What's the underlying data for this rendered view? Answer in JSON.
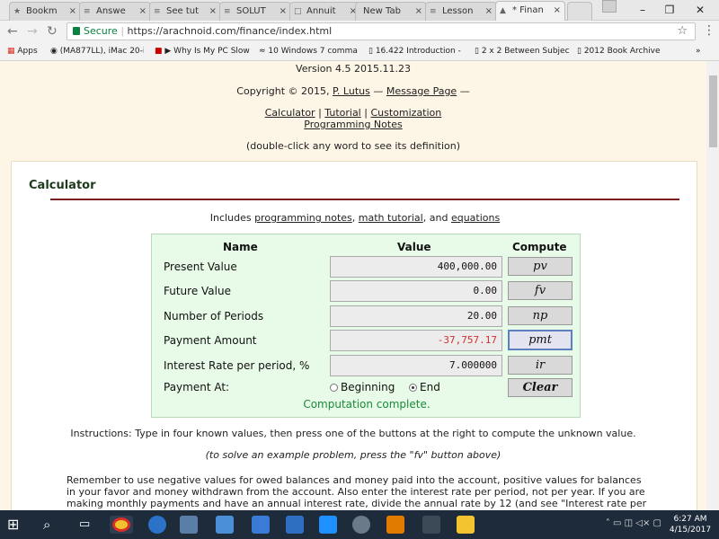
{
  "tabs": [
    {
      "label": "Bookm",
      "icon": "★"
    },
    {
      "label": "Answe",
      "icon": "≡"
    },
    {
      "label": "See tut",
      "icon": "≡"
    },
    {
      "label": "SOLUT",
      "icon": "≡"
    },
    {
      "label": "Annuit",
      "icon": "□"
    },
    {
      "label": "New Tab",
      "icon": ""
    },
    {
      "label": "Lesson",
      "icon": "≡"
    },
    {
      "label": "* Finan",
      "icon": "▲"
    }
  ],
  "address": {
    "secure": "Secure",
    "url": "https://arachnoid.com/finance/index.html"
  },
  "bookmarks": [
    {
      "label": "Apps"
    },
    {
      "label": "(MA877LL), iMac 20-i"
    },
    {
      "label": "▶ Why Is My PC Slow"
    },
    {
      "label": "10 Windows 7 comma"
    },
    {
      "label": "16.422 Introduction -"
    },
    {
      "label": "2 x 2 Between Subjec"
    },
    {
      "label": "2012 Book Archive"
    }
  ],
  "header": {
    "version": "Version 4.5 2015.11.23",
    "copyright_pre": "Copyright © 2015,",
    "author": "P. Lutus",
    "dash": "—",
    "message": "Message Page",
    "dash2": "—",
    "links": [
      "Calculator",
      "Tutorial",
      "Customization",
      "Programming Notes"
    ],
    "sep": "|",
    "hint": "(double-click any word to see its definition)"
  },
  "section_title": "Calculator",
  "includes": {
    "pre": "Includes",
    "l1": "programming notes",
    "c1": ",",
    "l2": "math tutorial",
    "c2": ", and",
    "l3": "equations"
  },
  "calculator": {
    "col_name": "Name",
    "col_value": "Value",
    "col_compute": "Compute",
    "rows": [
      {
        "label": "Present Value",
        "value": "400,000.00",
        "button": "pv",
        "color": "#111111"
      },
      {
        "label": "Future Value",
        "value": "0.00",
        "button": "fv",
        "color": "#111111"
      },
      {
        "label": "Number of Periods",
        "value": "20.00",
        "button": "np",
        "color": "#111111"
      },
      {
        "label": "Payment Amount",
        "value": "-37,757.17",
        "button": "pmt",
        "color": "#d32f2f"
      },
      {
        "label": "Interest Rate per period, %",
        "value": "7.000000",
        "button": "ir",
        "color": "#111111"
      }
    ],
    "payment_at": "Payment At:",
    "beginning": "Beginning",
    "end": "End",
    "selected": "End",
    "clear": "Clear",
    "status": "Computation complete."
  },
  "instructions": "Instructions: Type in four known values, then press one of the buttons at the right to compute the unknown value.",
  "example": "(to solve an example problem, press the \"fv\" button above)",
  "remember": "Remember to use negative values for owed balances and money paid into the account, positive values for balances in your favor and money withdrawn from the account. Also enter the interest rate per period, not per year. If you are making monthly payments and have an annual interest rate, divide the annual rate by 12 (and see \"Interest rate per",
  "clock": {
    "time": "6:27 AM",
    "date": "4/15/2017"
  }
}
